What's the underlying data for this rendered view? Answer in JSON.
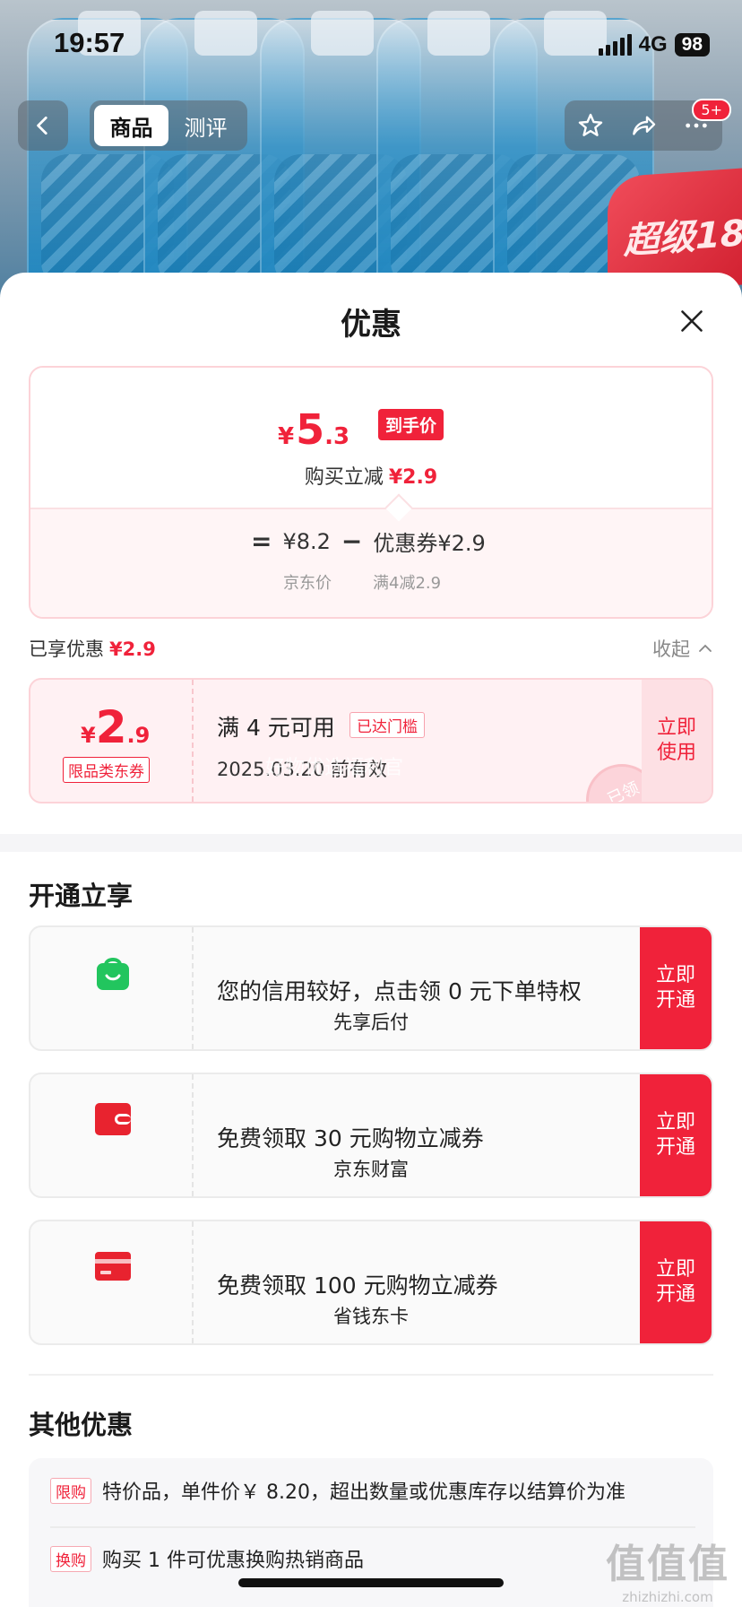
{
  "status_bar": {
    "time": "19:57",
    "network": "4G",
    "battery": "98"
  },
  "nav": {
    "tabs": [
      {
        "label": "商品",
        "active": true
      },
      {
        "label": "测评",
        "active": false
      }
    ],
    "badge": "5+",
    "promo_label": "超级18"
  },
  "sheet": {
    "title": "优惠",
    "price_card": {
      "currency": "¥",
      "final_int": "5",
      "final_dec": ".3",
      "final_tag": "到手价",
      "reduce_label": "购买立减",
      "reduce_amount": "¥2.9",
      "eq": "=",
      "jd_price": "¥8.2",
      "minus": "−",
      "coupon_price": "优惠券¥2.9",
      "jd_price_label": "京东价",
      "coupon_rule": "满4减2.9"
    },
    "enjoyed": {
      "label": "已享优惠",
      "amount": "¥2.9",
      "collapse": "收起"
    },
    "coupon": {
      "currency": "¥",
      "amount_int": "2",
      "amount_dec": ".9",
      "type": "限品类东券",
      "condition": "满 4 元可用",
      "status_tag": "已达门槛",
      "expiry": "2025.03.20 前有效",
      "use_button": "立即使用",
      "stamp": "已领"
    },
    "open_section": {
      "title": "开通立享",
      "items": [
        {
          "icon": "shopping-bag-icon",
          "name": "先享后付",
          "desc": "您的信用较好，点击领 0 元下单特权",
          "button": "立即开通",
          "color": "#22c55e"
        },
        {
          "icon": "wallet-icon",
          "name": "京东财富",
          "desc": "免费领取 30 元购物立减券",
          "button": "立即开通",
          "color": "#e8232f"
        },
        {
          "icon": "card-icon",
          "name": "省钱东卡",
          "desc": "免费领取 100 元购物立减券",
          "button": "立即开通",
          "color": "#e8232f"
        }
      ]
    },
    "other_section": {
      "title": "其他优惠",
      "items": [
        {
          "tag": "限购",
          "text": "特价品，单件价￥ 8.20，超出数量或优惠库存以结算价为准"
        },
        {
          "tag": "换购",
          "text": "购买 1 件可优惠换购热销商品"
        }
      ]
    }
  },
  "watermark": {
    "main": "值值值",
    "sub": "zhizhizhi.com",
    "center": "好物优选福利官"
  },
  "colors": {
    "accent": "#f0223a",
    "coupon_bg": "#fff1f3",
    "section_bg": "#f5f5f7"
  }
}
